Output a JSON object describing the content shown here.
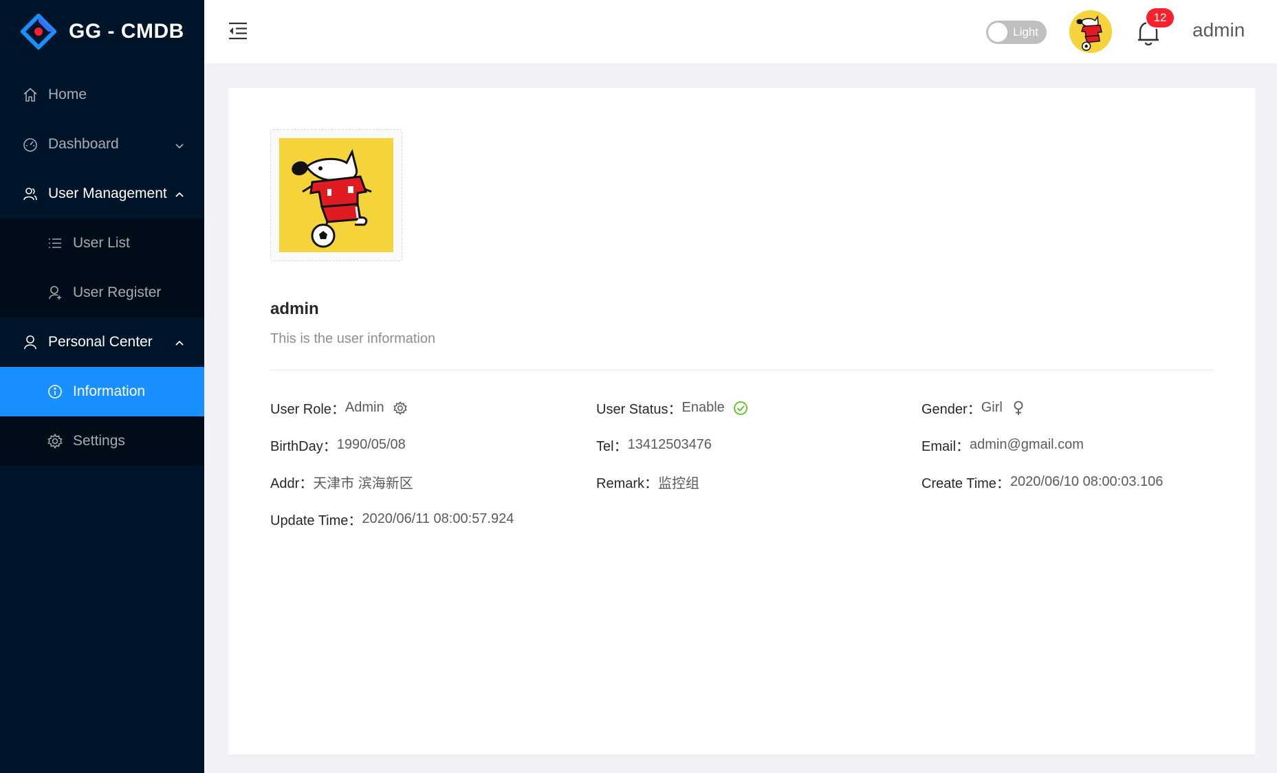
{
  "app": {
    "title": "GG - CMDB"
  },
  "sidebar": {
    "items": [
      {
        "label": "Home",
        "icon": "home-icon"
      },
      {
        "label": "Dashboard",
        "icon": "dashboard-icon"
      },
      {
        "label": "User Management",
        "icon": "team-icon",
        "children": [
          {
            "label": "User List",
            "icon": "list-icon"
          },
          {
            "label": "User Register",
            "icon": "user-add-icon"
          }
        ]
      },
      {
        "label": "Personal Center",
        "icon": "user-icon",
        "children": [
          {
            "label": "Information",
            "icon": "info-circle-icon",
            "selected": true
          },
          {
            "label": "Settings",
            "icon": "setting-icon"
          }
        ]
      }
    ]
  },
  "header": {
    "theme_label": "Light",
    "notification_count": "12",
    "username": "admin"
  },
  "profile": {
    "name": "admin",
    "description": "This is the user information",
    "fields": {
      "role": {
        "label": "User Role：",
        "value": "Admin"
      },
      "status": {
        "label": "User Status：",
        "value": "Enable"
      },
      "gender": {
        "label": "Gender：",
        "value": "Girl"
      },
      "birthday": {
        "label": "BirthDay：",
        "value": "1990/05/08"
      },
      "tel": {
        "label": "Tel：",
        "value": "13412503476"
      },
      "email": {
        "label": "Email：",
        "value": "admin@gmail.com"
      },
      "addr": {
        "label": "Addr：",
        "value": "天津市 滨海新区"
      },
      "remark": {
        "label": "Remark：",
        "value": "监控组"
      },
      "create_time": {
        "label": "Create Time：",
        "value": "2020/06/10 08:00:03.106"
      },
      "update_time": {
        "label": "Update Time：",
        "value": "2020/06/11 08:00:57.924"
      }
    }
  },
  "colors": {
    "sidebar_bg": "#001529",
    "submenu_bg": "#000c17",
    "primary": "#1890ff",
    "badge": "#f5222d",
    "success": "#52c41a"
  }
}
